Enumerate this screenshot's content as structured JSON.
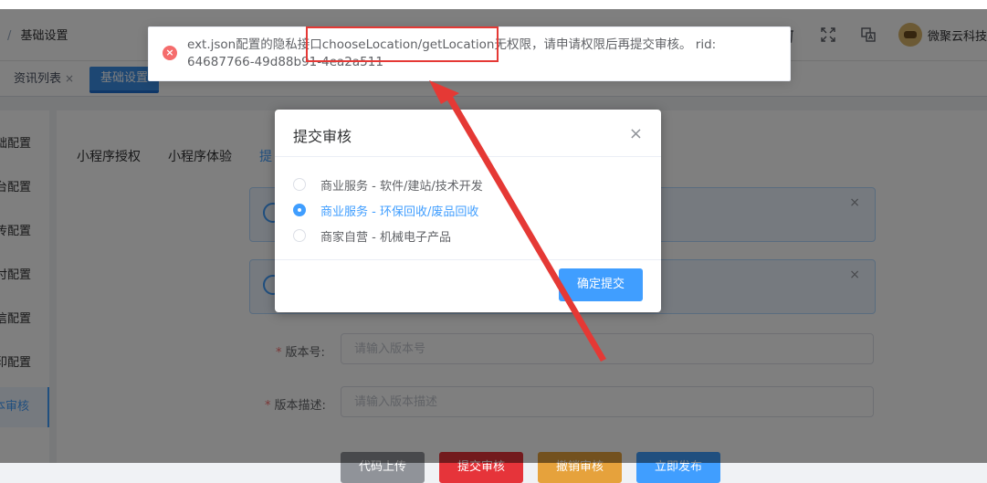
{
  "header": {
    "breadcrumb": {
      "sep": "/",
      "current": "基础设置"
    },
    "user": {
      "name": "微聚云科技"
    },
    "icons": [
      "trash-icon",
      "fullscreen-icon",
      "translate-icon"
    ]
  },
  "tags": [
    {
      "label": "资讯列表",
      "active": false,
      "close": "×"
    },
    {
      "label": "基础设置",
      "active": true,
      "close": ""
    }
  ],
  "sidebar": {
    "items": [
      {
        "label": "础配置"
      },
      {
        "label": "台配置"
      },
      {
        "label": "传配置"
      },
      {
        "label": "付配置"
      },
      {
        "label": "信配置"
      },
      {
        "label": "印配置"
      },
      {
        "label": "本审核",
        "active": true
      }
    ]
  },
  "subtabs": [
    {
      "label": "小程序授权"
    },
    {
      "label": "小程序体验"
    },
    {
      "label": "提",
      "active": true
    }
  ],
  "alerts": [
    {
      "close": "×"
    },
    {
      "close": "×"
    }
  ],
  "form": {
    "version": {
      "label": "版本号:",
      "required": "*",
      "placeholder": "请输入版本号"
    },
    "desc": {
      "label": "版本描述:",
      "required": "*",
      "placeholder": "请输入版本描述"
    }
  },
  "buttons": {
    "upload": "代码上传",
    "submit": "提交审核",
    "revoke": "撤销审核",
    "publish": "立即发布"
  },
  "colors": {
    "upload": "#909399",
    "submit": "#e6343a",
    "revoke": "#e6a23c",
    "publish": "#409eff"
  },
  "dialog": {
    "title": "提交审核",
    "close": "×",
    "options": [
      {
        "label": "商业服务 - 软件/建站/技术开发",
        "checked": false
      },
      {
        "label": "商业服务 - 环保回收/废品回收",
        "checked": true
      },
      {
        "label": "商家自营 - 机械电子产品",
        "checked": false
      }
    ],
    "confirm": "确定提交"
  },
  "message": {
    "type": "error",
    "icon": "×",
    "text": "ext.json配置的隐私接口chooseLocation/getLocation无权限，请申请权限后再提交审核。 rid: 64687766-49d88b91-4ea2a511"
  }
}
